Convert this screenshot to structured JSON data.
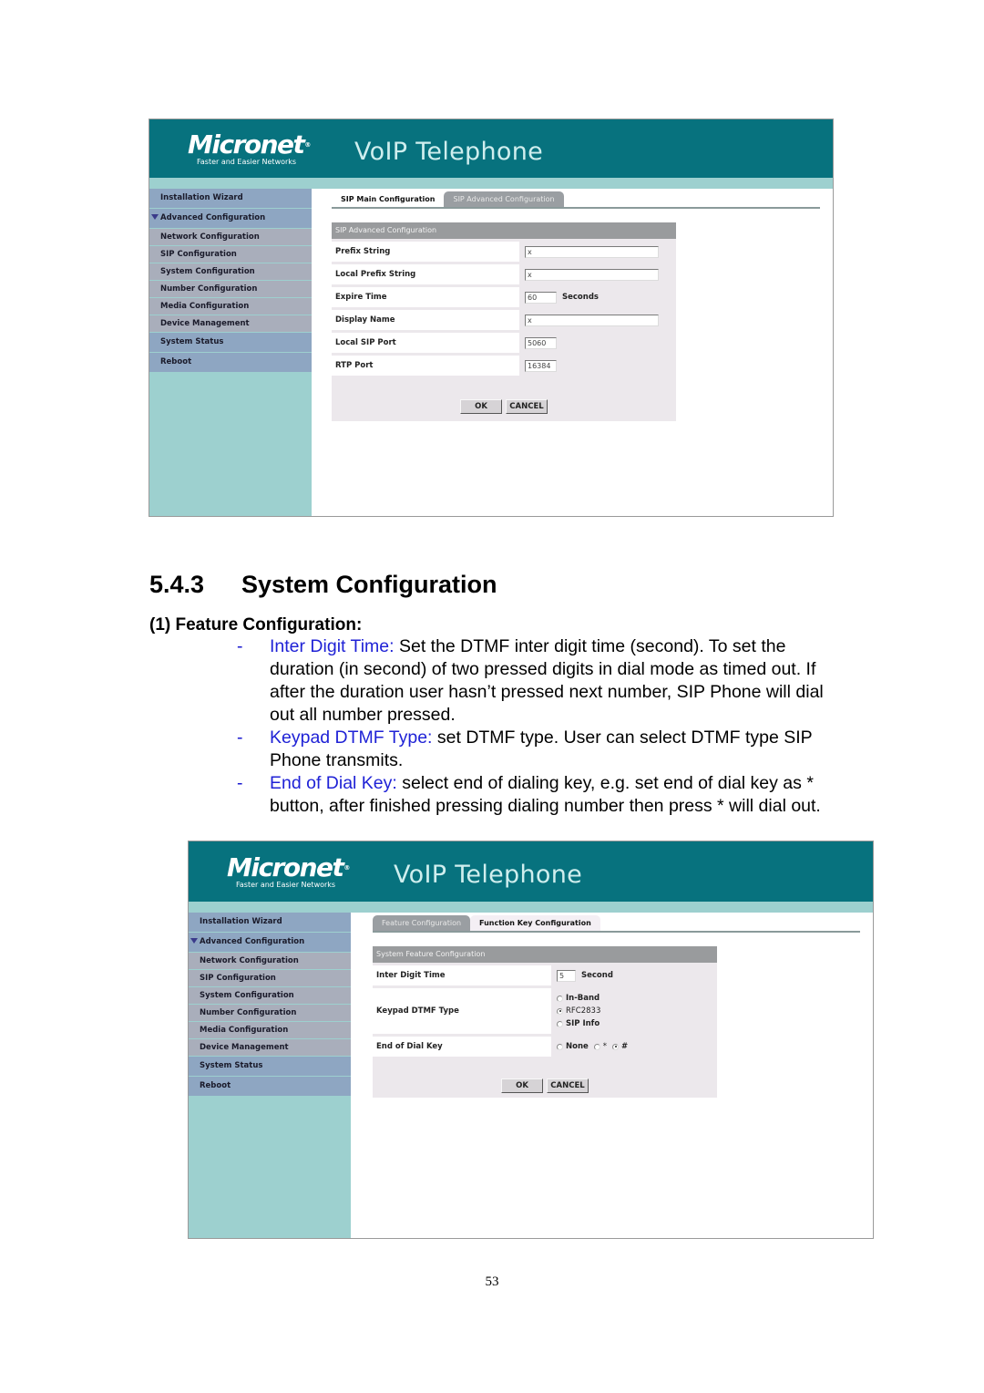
{
  "screenshot1": {
    "brand": {
      "logo": "Micronet",
      "registered": "®",
      "tagline": "Faster and Easier Networks",
      "title": "VoIP Telephone"
    },
    "sidebar": [
      {
        "label": "Installation Wizard",
        "type": "top"
      },
      {
        "label": "Advanced Configuration",
        "type": "expanded"
      },
      {
        "label": "Network Configuration",
        "type": "sub"
      },
      {
        "label": "SIP Configuration",
        "type": "sub"
      },
      {
        "label": "System Configuration",
        "type": "sub"
      },
      {
        "label": "Number Configuration",
        "type": "sub"
      },
      {
        "label": "Media Configuration",
        "type": "sub"
      },
      {
        "label": "Device Management",
        "type": "sub"
      },
      {
        "label": "System Status",
        "type": "top"
      },
      {
        "label": "Reboot",
        "type": "top"
      }
    ],
    "tabs": [
      {
        "label": "SIP Main Configuration",
        "active": true
      },
      {
        "label": "SIP Advanced Configuration",
        "active": false
      }
    ],
    "panel_title": "SIP Advanced Configuration",
    "fields": [
      {
        "label": "Prefix String",
        "value": "x",
        "unit": ""
      },
      {
        "label": "Local Prefix String",
        "value": "x",
        "unit": ""
      },
      {
        "label": "Expire Time",
        "value": "60",
        "unit": "Seconds"
      },
      {
        "label": "Display Name",
        "value": "x",
        "unit": ""
      },
      {
        "label": "Local SIP Port",
        "value": "5060",
        "unit": ""
      },
      {
        "label": "RTP Port",
        "value": "16384",
        "unit": ""
      }
    ],
    "buttons": {
      "ok": "OK",
      "cancel": "CANCEL"
    }
  },
  "document": {
    "section_number": "5.4.3",
    "section_title": "System Configuration",
    "subsection": "(1) Feature Configuration:",
    "bullets": [
      {
        "dash": "-",
        "term": "Inter Digit Time:",
        "text": " Set the DTMF inter digit time (second). To set the duration (in second) of two pressed digits in dial mode as timed out. If after the duration user hasn’t pressed next number, SIP Phone will dial out all number pressed."
      },
      {
        "dash": "-",
        "term": "Keypad DTMF Type:",
        "text": " set DTMF type. User can select DTMF type SIP Phone transmits."
      },
      {
        "dash": "-",
        "term": "End of Dial Key:",
        "text": " select end of dialing key, e.g. set end of dial key as * button, after finished pressing dialing number then press * will dial out."
      }
    ],
    "page_number": "53"
  },
  "screenshot2": {
    "brand": {
      "logo": "Micronet",
      "registered": "®",
      "tagline": "Faster and Easier Networks",
      "title": "VoIP Telephone"
    },
    "sidebar": [
      {
        "label": "Installation Wizard",
        "type": "top"
      },
      {
        "label": "Advanced Configuration",
        "type": "expanded"
      },
      {
        "label": "Network Configuration",
        "type": "sub"
      },
      {
        "label": "SIP Configuration",
        "type": "sub"
      },
      {
        "label": "System Configuration",
        "type": "sub"
      },
      {
        "label": "Number Configuration",
        "type": "sub"
      },
      {
        "label": "Media Configuration",
        "type": "sub"
      },
      {
        "label": "Device Management",
        "type": "sub"
      },
      {
        "label": "System Status",
        "type": "top"
      },
      {
        "label": "Reboot",
        "type": "top"
      }
    ],
    "tabs": [
      {
        "label": "Feature Configuration",
        "active": false
      },
      {
        "label": "Function Key Configuration",
        "active": true
      }
    ],
    "panel_title": "System Feature Configuration",
    "inter_digit": {
      "label": "Inter Digit Time",
      "value": "5",
      "unit": "Second"
    },
    "dtmf": {
      "label": "Keypad DTMF Type",
      "options": [
        {
          "label": "In-Band",
          "selected": false
        },
        {
          "label": "RFC2833",
          "selected": true
        },
        {
          "label": "SIP Info",
          "selected": false
        }
      ]
    },
    "end_key": {
      "label": "End of Dial Key",
      "options": [
        {
          "label": "None",
          "selected": false
        },
        {
          "label": "*",
          "selected": false
        },
        {
          "label": "#",
          "selected": true
        }
      ]
    },
    "buttons": {
      "ok": "OK",
      "cancel": "CANCEL"
    }
  }
}
